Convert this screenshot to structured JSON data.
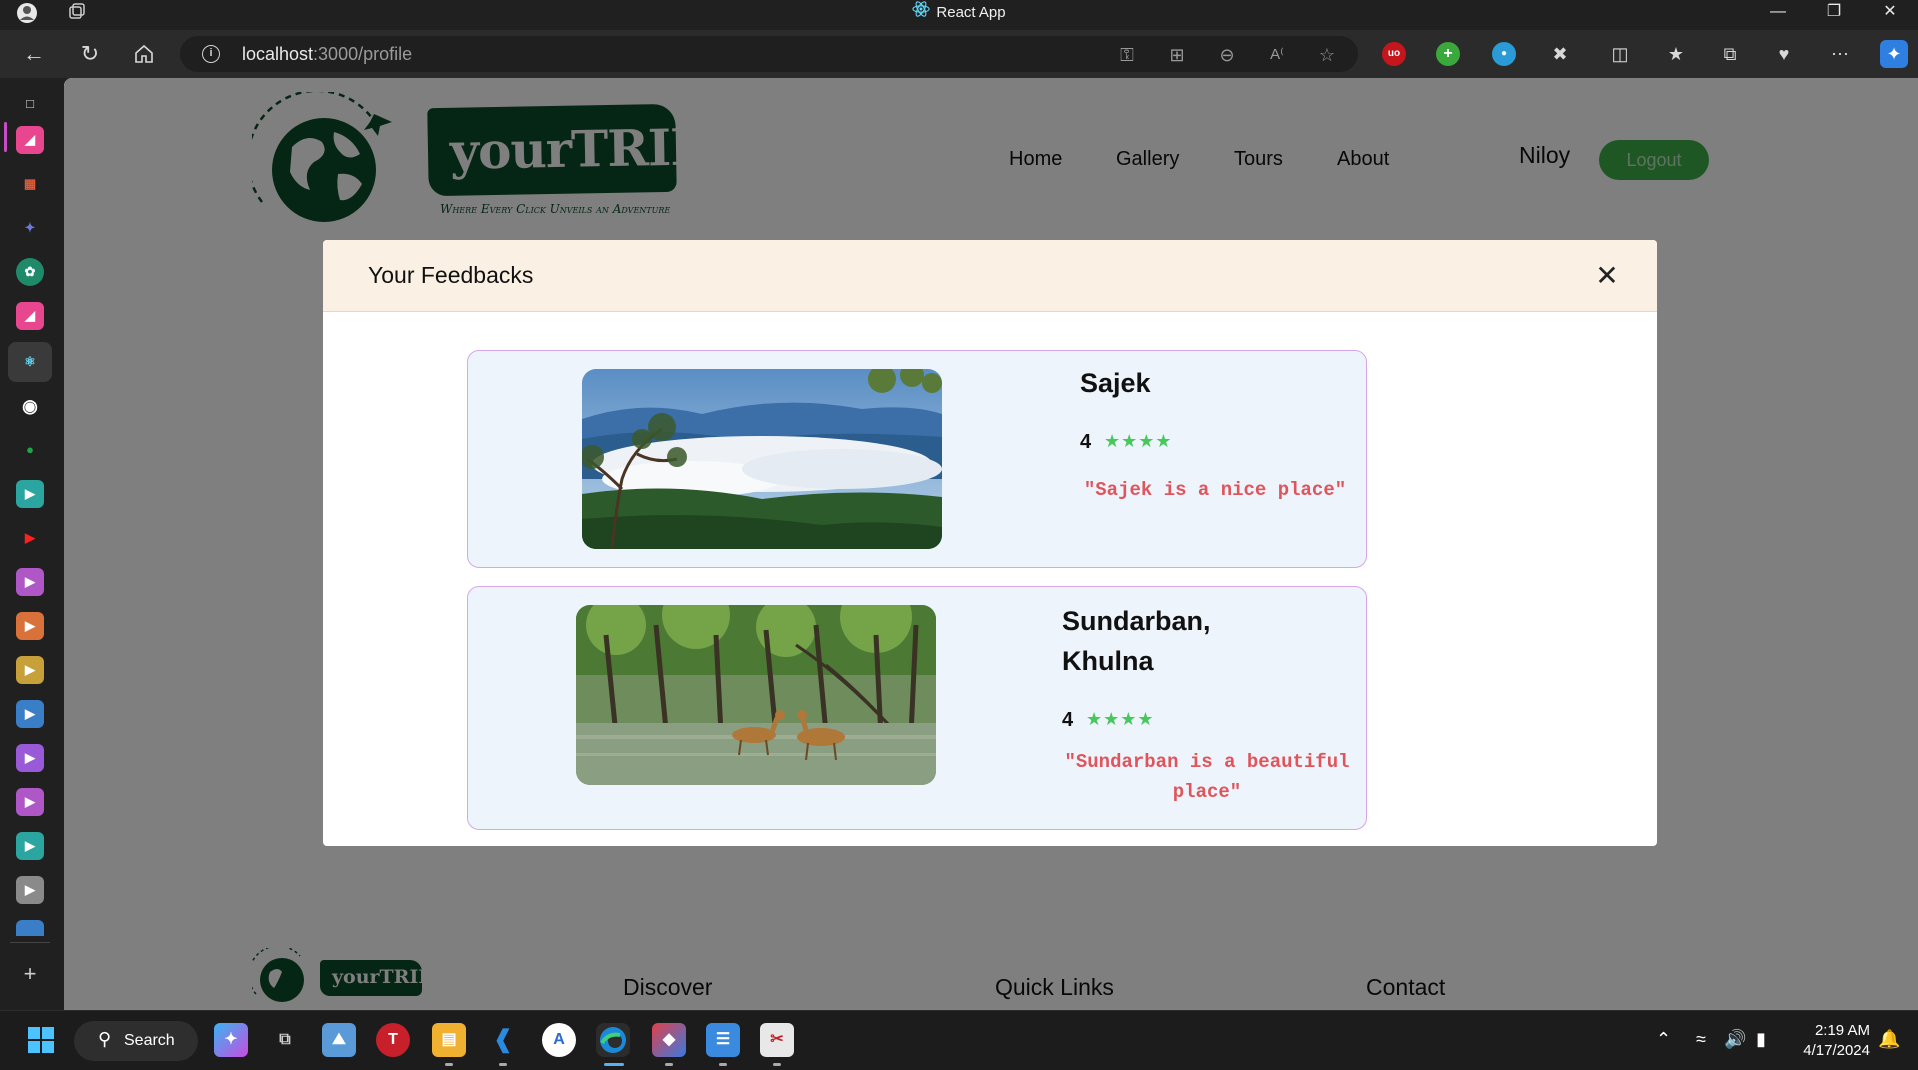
{
  "window": {
    "title": "React App"
  },
  "address_bar": {
    "url_host": "localhost",
    "url_rest": ":3000/profile"
  },
  "site": {
    "logo_text": "yourTRIP",
    "logo_tagline": "Where Every Click Unveils an Adventure",
    "nav": [
      "Home",
      "Gallery",
      "Tours",
      "About"
    ],
    "username": "Niloy",
    "logout_label": "Logout"
  },
  "modal": {
    "title": "Your Feedbacks",
    "close_symbol": "✕",
    "feedbacks": [
      {
        "place": "Sajek",
        "rating": "4",
        "stars": "★★★★",
        "comment": "\"Sajek is a nice place\""
      },
      {
        "place_line1": "Sundarban,",
        "place_line2": "Khulna",
        "rating": "4",
        "stars": "★★★★",
        "comment_line1": "\"Sundarban is a beautiful",
        "comment_line2": "place\""
      }
    ]
  },
  "footer": {
    "logo_text": "yourTRIP",
    "headings": [
      "Discover",
      "Quick Links",
      "Contact"
    ]
  },
  "taskbar": {
    "search_label": "Search",
    "time": "2:19 AM",
    "date": "4/17/2024"
  },
  "colors": {
    "brand_green": "#0b4d2b",
    "logout_green": "#3fae49",
    "star_green": "#46c85a",
    "comment_red": "#e0555c",
    "modal_header_bg": "#faf1e4",
    "card_bg": "#eef4fc",
    "card_border": "#d6a6e6"
  }
}
